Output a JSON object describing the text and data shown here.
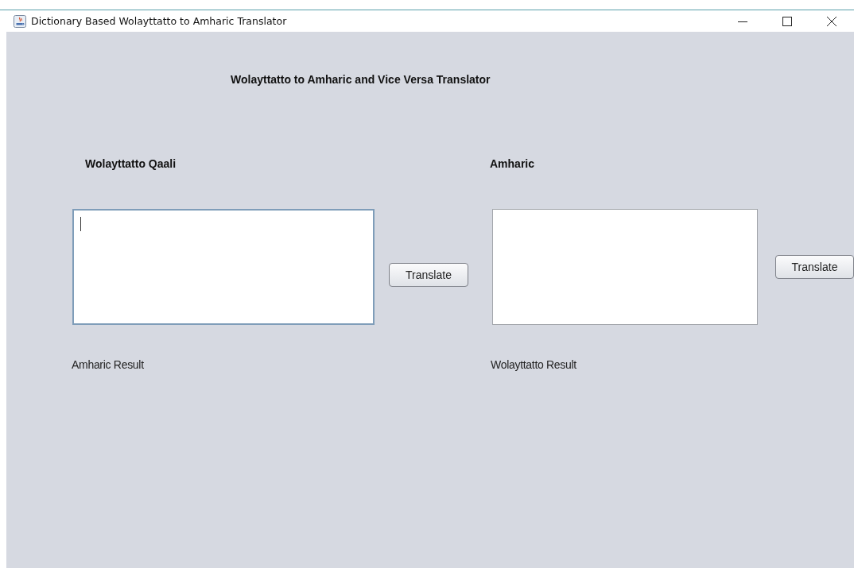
{
  "window": {
    "title": "Dictionary Based Wolayttatto to Amharic Translator"
  },
  "heading": "Wolayttatto to Amharic and Vice Versa Translator",
  "panels": [
    {
      "label": "Wolayttatto Qaali",
      "input": {
        "focused": true
      },
      "button": "Translate",
      "result": "Amharic Result"
    },
    {
      "label": "Amharic",
      "input": {
        "focused": false
      },
      "button": "Translate",
      "result": "Wolayttatto Result"
    }
  ]
}
